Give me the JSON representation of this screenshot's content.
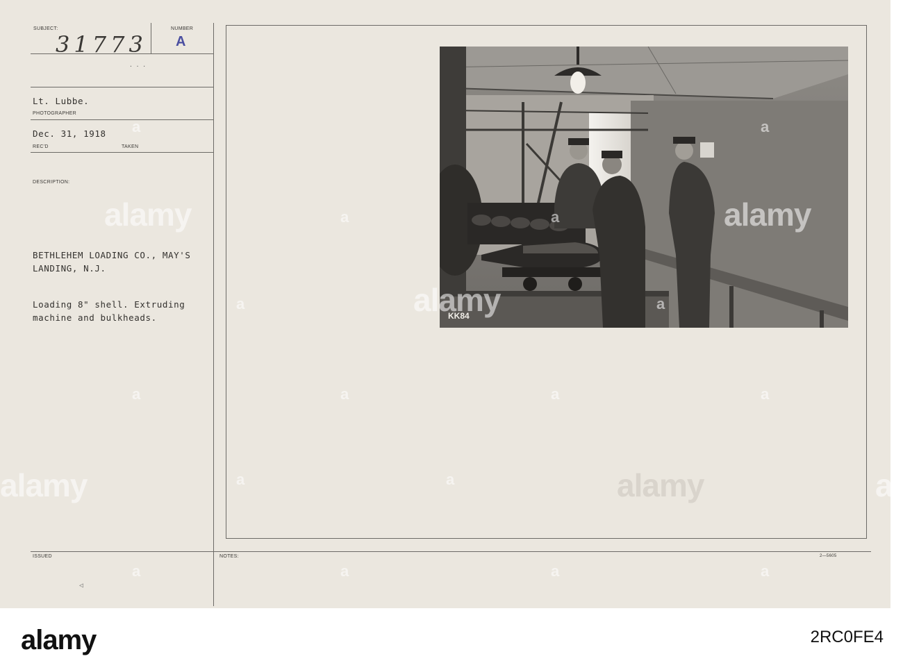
{
  "card": {
    "subject_label": "SUBJECT:",
    "subject_number": "31773",
    "number_label": "NUMBER",
    "number_value": "A",
    "photographer_name": "Lt. Lubbe.",
    "photographer_label": "PHOTOGRAPHER",
    "date_value": "Dec. 31, 1918",
    "recd_label": "REC'D",
    "taken_label": "TAKEN",
    "description_label": "DESCRIPTION:",
    "description_lines": [
      "BETHLEHEM LOADING CO., MAY'S",
      "LANDING, N.J.",
      "Loading 8\" shell. Extruding",
      "machine and bulkheads."
    ],
    "issued_label": "ISSUED",
    "notes_label": "NOTES:",
    "form_code": "2—5605",
    "photo_stamp": "KK84"
  },
  "stock": {
    "watermark": "alamy",
    "watermark_mark": "a",
    "logo": "alamy",
    "image_id": "2RC0FE4"
  }
}
